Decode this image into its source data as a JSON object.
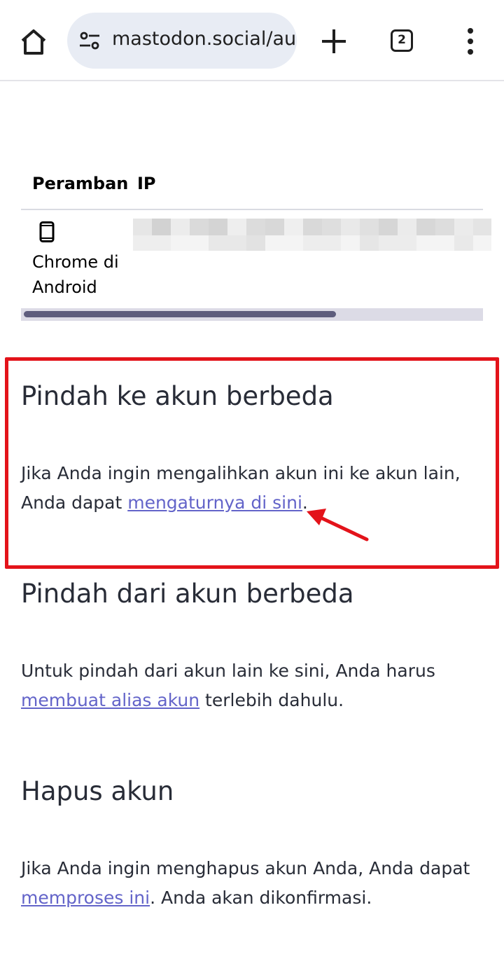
{
  "browser": {
    "url": "mastodon.social/auth/edit",
    "tab_count": "2"
  },
  "sessions_table": {
    "headers": [
      "Peramban",
      "IP"
    ],
    "rows": [
      {
        "browser_line1": "Chrome di",
        "browser_line2": "Android",
        "ip": ""
      }
    ]
  },
  "sections": {
    "move_to": {
      "title": "Pindah ke akun berbeda",
      "text_before": "Jika Anda ingin mengalihkan akun ini ke akun lain, Anda dapat ",
      "link": "mengaturnya di sini",
      "text_after": "."
    },
    "move_from": {
      "title": "Pindah dari akun berbeda",
      "text_before": "Untuk pindah dari akun lain ke sini, Anda harus ",
      "link": "membuat alias akun",
      "text_after": " terlebih dahulu."
    },
    "delete": {
      "title": "Hapus akun",
      "text_before": "Jika Anda ingin menghapus akun Anda, Anda dapat ",
      "link": "memproses ini",
      "text_after": ". Anda akan dikonfirmasi."
    }
  },
  "colors": {
    "highlight": "#e3131a",
    "link": "#6364c9"
  }
}
